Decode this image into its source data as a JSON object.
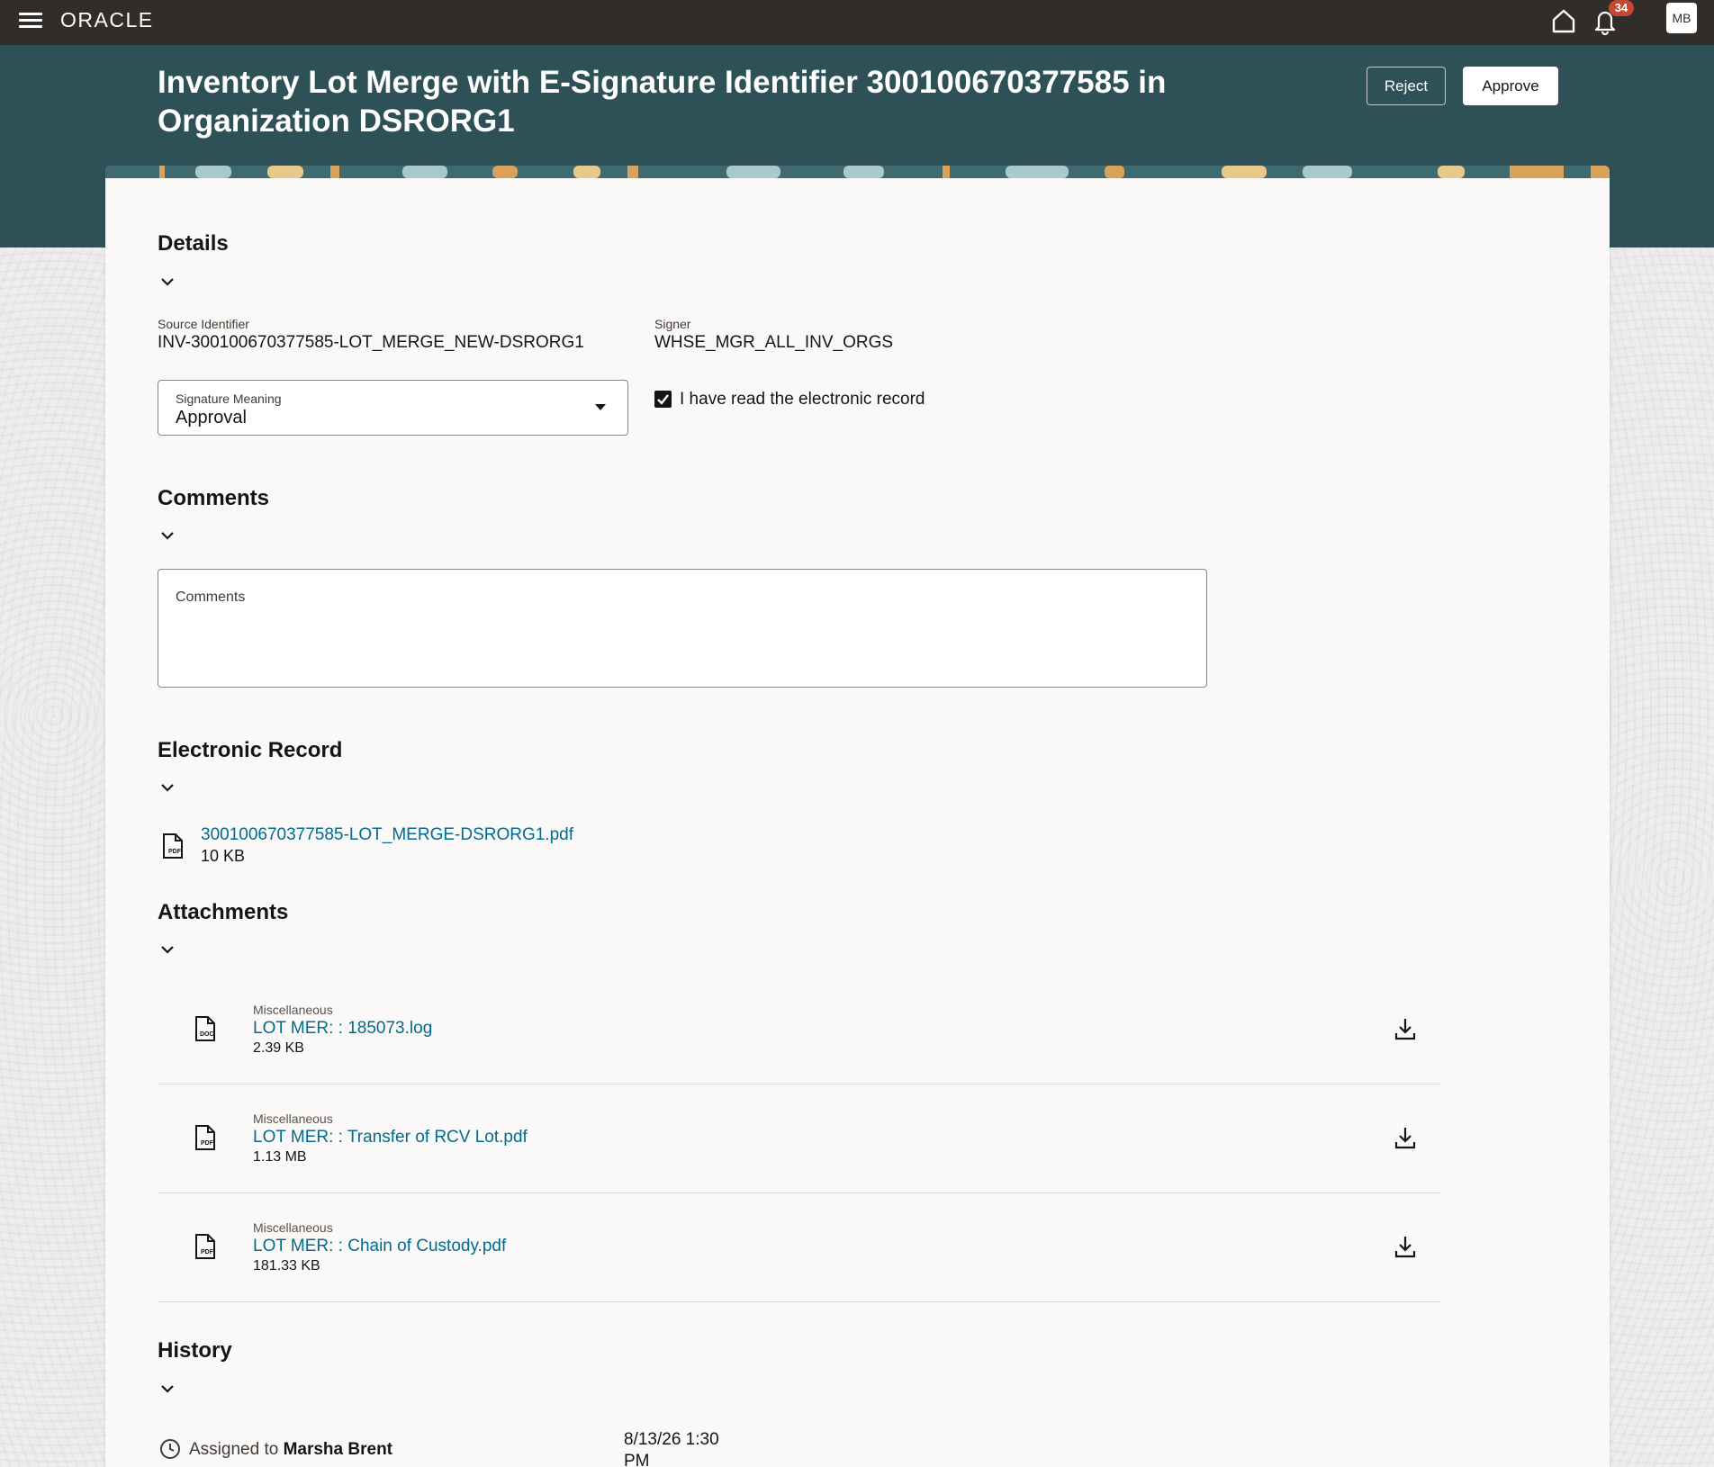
{
  "topbar": {
    "logo": "ORACLE",
    "notification_count": "34",
    "avatar_initials": "MB"
  },
  "header": {
    "title": "Inventory Lot Merge with E-Signature Identifier 300100670377585 in Organization DSRORG1",
    "reject_label": "Reject",
    "approve_label": "Approve"
  },
  "details": {
    "title": "Details",
    "source_identifier_label": "Source Identifier",
    "source_identifier_value": "INV-300100670377585-LOT_MERGE_NEW-DSRORG1",
    "signer_label": "Signer",
    "signer_value": "WHSE_MGR_ALL_INV_ORGS",
    "signature_meaning_label": "Signature Meaning",
    "signature_meaning_value": "Approval",
    "read_record_label": "I have read the electronic record",
    "read_record_checked": true
  },
  "comments": {
    "title": "Comments",
    "field_label": "Comments",
    "value": ""
  },
  "electronic_record": {
    "title": "Electronic Record",
    "file_name": "300100670377585-LOT_MERGE-DSRORG1.pdf",
    "file_size": "10 KB",
    "file_type": "PDF"
  },
  "attachments": {
    "title": "Attachments",
    "items": [
      {
        "category": "Miscellaneous",
        "name": "LOT MER: : 185073.log",
        "size": "2.39 KB",
        "type": "DOC"
      },
      {
        "category": "Miscellaneous",
        "name": "LOT MER: : Transfer of RCV Lot.pdf",
        "size": "1.13 MB",
        "type": "PDF"
      },
      {
        "category": "Miscellaneous",
        "name": "LOT MER: : Chain of Custody.pdf",
        "size": "181.33 KB",
        "type": "PDF"
      }
    ]
  },
  "history": {
    "title": "History",
    "entries": [
      {
        "action": "Assigned to",
        "person": "Marsha Brent",
        "date": "8/13/26 1:30 PM"
      }
    ]
  },
  "colors": {
    "topbar": "#312d2a",
    "header_band": "#2d5157",
    "link": "#006b8f",
    "badge": "#c74634"
  }
}
